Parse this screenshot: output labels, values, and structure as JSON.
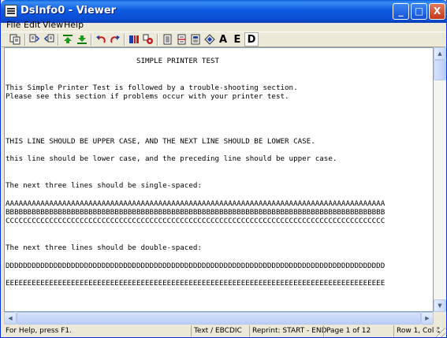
{
  "window": {
    "title": "DsInfo0 - Viewer"
  },
  "title_buttons": {
    "minimize": "_",
    "maximize": "□",
    "close": "X"
  },
  "menu": [
    "File",
    "Edit",
    "View",
    "Help"
  ],
  "toolbar": {
    "letters": [
      "A",
      "E",
      "D"
    ],
    "icons": [
      "copy-icon",
      "find-icon",
      "find-next-icon",
      "top-icon",
      "bottom-icon",
      "undo-icon",
      "redo-icon",
      "print-icon",
      "settings-icon",
      "page-icon",
      "page-break-icon",
      "doc-icon",
      "diamond-icon"
    ]
  },
  "document": {
    "lines": [
      "                              SIMPLE PRINTER TEST",
      "",
      "",
      "This Simple Printer Test is followed by a trouble-shooting section.",
      "Please see this section if problems occur with your printer test.",
      "",
      "",
      "",
      "",
      "THIS LINE SHOULD BE UPPER CASE, AND THE NEXT LINE SHOULD BE LOWER CASE.",
      "",
      "this line should be lower case, and the preceding line should be upper case.",
      "",
      "",
      "The next three lines should be single-spaced:",
      "",
      "AAAAAAAAAAAAAAAAAAAAAAAAAAAAAAAAAAAAAAAAAAAAAAAAAAAAAAAAAAAAAAAAAAAAAAAAAAAAAAAAAAAAAAA",
      "BBBBBBBBBBBBBBBBBBBBBBBBBBBBBBBBBBBBBBBBBBBBBBBBBBBBBBBBBBBBBBBBBBBBBBBBBBBBBBBBBBBBBBB",
      "CCCCCCCCCCCCCCCCCCCCCCCCCCCCCCCCCCCCCCCCCCCCCCCCCCCCCCCCCCCCCCCCCCCCCCCCCCCCCCCCCCCCCCC",
      "",
      "",
      "The next three lines should be double-spaced:",
      "",
      "DDDDDDDDDDDDDDDDDDDDDDDDDDDDDDDDDDDDDDDDDDDDDDDDDDDDDDDDDDDDDDDDDDDDDDDDDDDDDDDDDDDDDDD",
      "",
      "EEEEEEEEEEEEEEEEEEEEEEEEEEEEEEEEEEEEEEEEEEEEEEEEEEEEEEEEEEEEEEEEEEEEEEEEEEEEEEEEEEEEEEE"
    ]
  },
  "status": {
    "help": "For Help, press F1.",
    "encoding": "Text / EBCDIC",
    "reprint": "Reprint: START - END",
    "page": "Page 1 of 12",
    "position": "Row 1, Col 1"
  },
  "colors": {
    "titlebar": "#0A5FDC",
    "chrome": "#ECE9D8"
  }
}
